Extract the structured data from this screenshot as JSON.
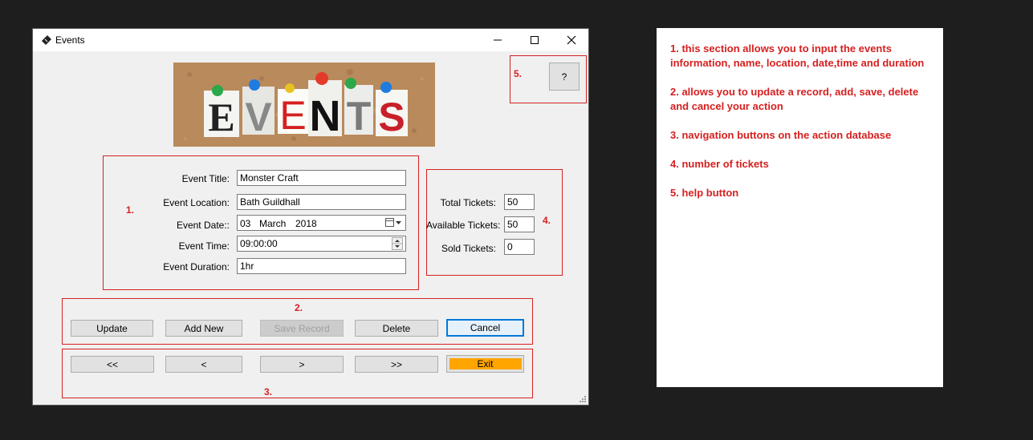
{
  "window": {
    "title": "Events",
    "minimize_glyph": "—",
    "close_glyph": "✕"
  },
  "banner": {
    "letters": [
      "E",
      "V",
      "E",
      "N",
      "T",
      "S"
    ]
  },
  "section_numbers": [
    "1.",
    "2.",
    "3.",
    "4.",
    "5."
  ],
  "help": {
    "label": "?"
  },
  "event_form": {
    "title_label": "Event Title:",
    "title_value": "Monster Craft",
    "location_label": "Event Location:",
    "location_value": "Bath Guildhall",
    "date_label": "Event Date::",
    "date_day": "03",
    "date_month": "March",
    "date_year": "2018",
    "time_label": "Event Time:",
    "time_value": "09:00:00",
    "duration_label": "Event Duration:",
    "duration_value": "1hr"
  },
  "tickets": {
    "total_label": "Total Tickets:",
    "total_value": "50",
    "available_label": "Available Tickets:",
    "available_value": "50",
    "sold_label": "Sold Tickets:",
    "sold_value": "0"
  },
  "actions": {
    "update": "Update",
    "add_new": "Add New",
    "save_record": "Save Record",
    "delete": "Delete",
    "cancel": "Cancel"
  },
  "navigation": {
    "first": "<<",
    "prev": "<",
    "next": ">",
    "last": ">>",
    "exit": "Exit"
  },
  "notes": [
    "1. this section allows you to input the events information, name, location, date,time and duration",
    "2. allows you to update a record, add, save, delete and cancel your action",
    "3. navigation buttons on the action database",
    "4. number of tickets",
    "5. help button"
  ],
  "colors": {
    "accent_red": "#d62020",
    "exit_orange": "#ffa500",
    "focus_blue": "#0078d7"
  }
}
